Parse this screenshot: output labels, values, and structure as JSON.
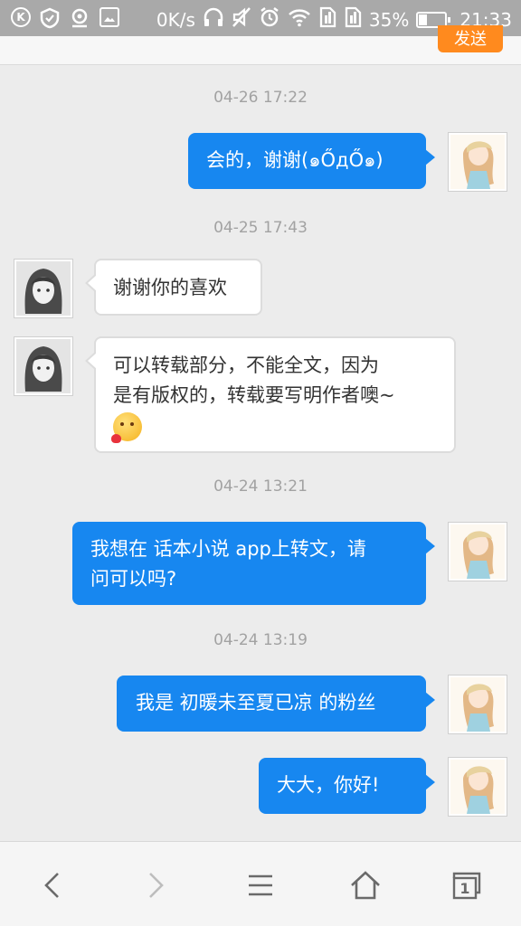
{
  "status_bar": {
    "net_speed": "0K/s",
    "battery_percent": "35%",
    "battery_level": 0.35,
    "time": "21:33",
    "icons": [
      "k-icon",
      "shield-icon",
      "location-icon",
      "image-icon",
      "headphones-icon",
      "mute-icon",
      "alarm-icon",
      "wifi-icon",
      "sim1-icon",
      "sim2-icon",
      "battery-icon"
    ]
  },
  "header": {
    "send_label": "发送"
  },
  "messages": [
    {
      "timestamp": "04-26 17:22",
      "direction": "out",
      "lines": [
        "会的，谢谢(๑ŐдŐ๑)"
      ]
    },
    {
      "timestamp": "04-25 17:43",
      "direction": "in",
      "lines": [
        "谢谢你的喜欢"
      ]
    },
    {
      "direction": "in",
      "lines": [
        "可以转载部分，不能全文，因为",
        "是有版权的，转载要写明作者噢~"
      ],
      "emoji": "blush-heart-emoji"
    },
    {
      "timestamp": "04-24 13:21",
      "direction": "out",
      "lines": [
        "我想在 话本小说 app上转文，请",
        "问可以吗?"
      ]
    },
    {
      "timestamp": "04-24 13:19",
      "direction": "out",
      "lines": [
        "我是 初暖未至夏已凉 的粉丝"
      ]
    },
    {
      "direction": "out",
      "lines": [
        "大大，你好!"
      ]
    }
  ],
  "nav": {
    "tab_count": "1",
    "icons": [
      "back-icon",
      "forward-icon",
      "menu-icon",
      "home-icon",
      "tabs-icon"
    ]
  },
  "colors": {
    "outgoing_bubble": "#1787f0",
    "send_button": "#ff8a1e",
    "status_bar": "#a9a9a9",
    "background": "#ececec"
  }
}
